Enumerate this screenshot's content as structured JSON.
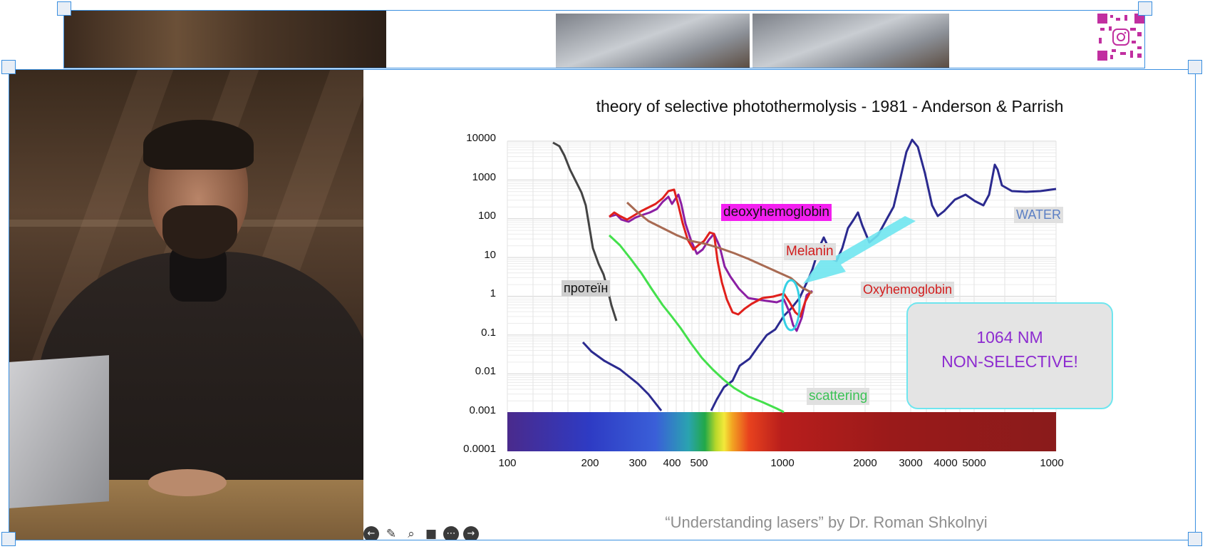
{
  "slide": {
    "title": "theory of selective photothermolysis - 1981 - Anderson & Parrish",
    "credits": "“Understanding lasers” by Dr. Roman Shkolnyi",
    "callout_line1": "1064  NM",
    "callout_line2": "NON-SELECTIVE!"
  },
  "toolbar": {
    "buttons": [
      "back",
      "pen",
      "zoom",
      "video",
      "more",
      "forward"
    ]
  },
  "chart_data": {
    "type": "line",
    "title": "theory of selective photothermolysis - 1981 - Anderson & Parrish",
    "xlabel": "",
    "ylabel": "",
    "x_scale": "log",
    "y_scale": "log",
    "x_ticks": [
      "100",
      "200",
      "300",
      "400",
      "500",
      "1000",
      "2000",
      "3000",
      "4000",
      "5000",
      "1000"
    ],
    "y_ticks": [
      "10000",
      "1000",
      "100",
      "10",
      "1",
      "0.1",
      "0.01",
      "0.001",
      "0.0001"
    ],
    "series_labels": {
      "deoxy": "deoxyhemoglobin",
      "melanin": "Melanin",
      "protein": "протеïн",
      "oxy": "Oxyhemoglobin",
      "water": "WATER",
      "scatter": "scattering"
    },
    "colors": {
      "deoxy": "#8b1fa3",
      "oxy": "#e0201c",
      "melanin": "#a86a52",
      "protein": "#444444",
      "water": "#2b2a8f",
      "scatter": "#44e04c",
      "arrow": "#6fe6ef"
    }
  },
  "overlay": {
    "qr_icon": "instagram-qr-icon"
  }
}
